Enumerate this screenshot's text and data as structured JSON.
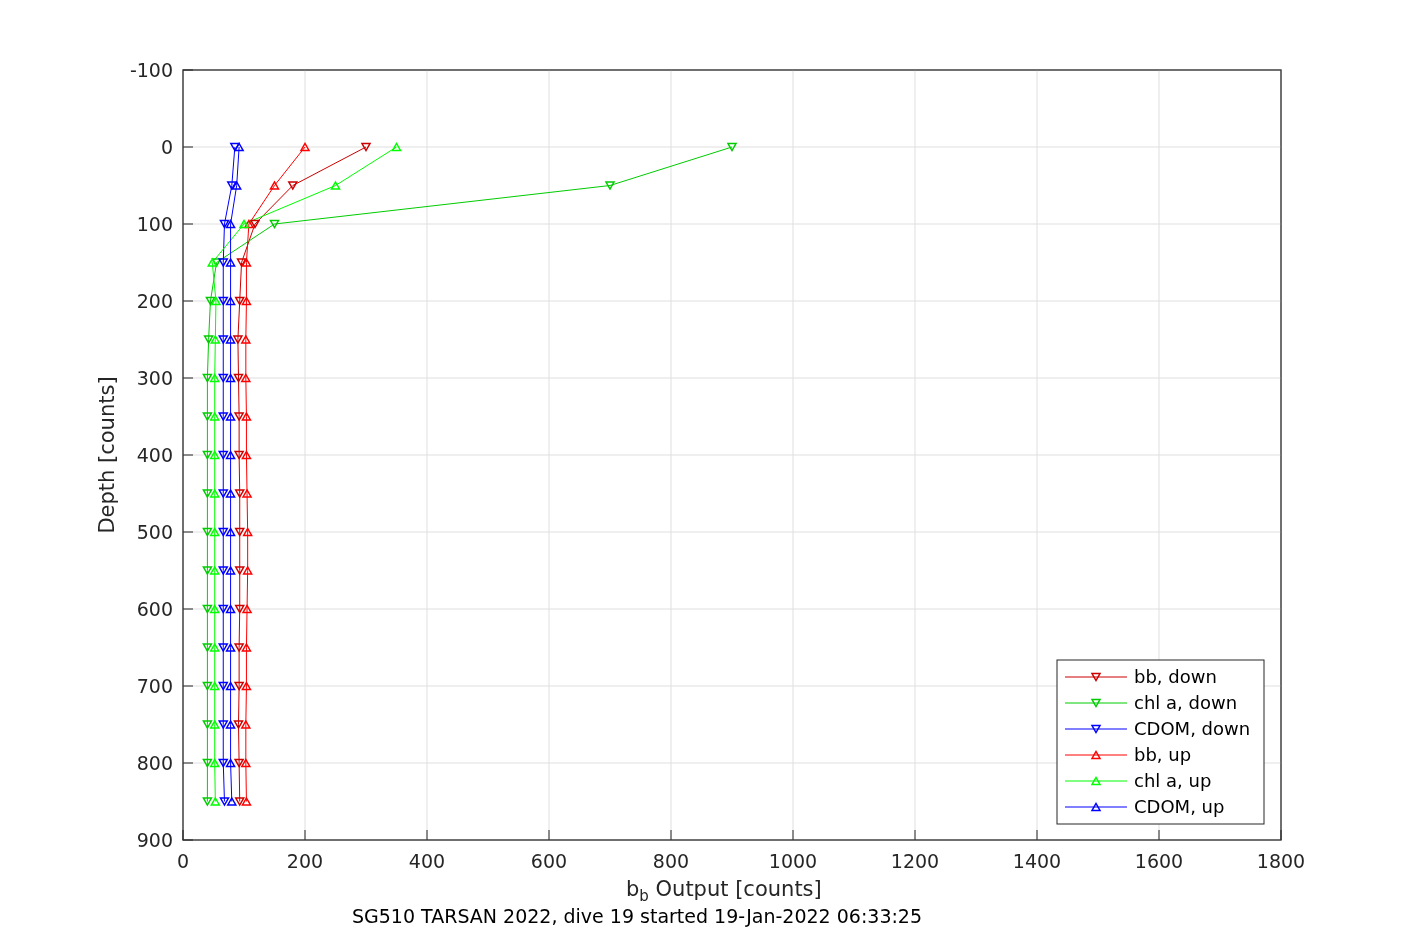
{
  "figure": {
    "chart_data": {
      "type": "line",
      "title": "SG510 TARSAN 2022, dive 19 started 19-Jan-2022 06:33:25",
      "xlabel": "b$_{b}$ Output [counts]",
      "ylabel": "Depth [counts]",
      "orientation": "horizontal",
      "grid": true,
      "legend": "lower right",
      "x": [
        0,
        50,
        100,
        150,
        200,
        250,
        300,
        350,
        400,
        450,
        500,
        550,
        600,
        650,
        700,
        750,
        800,
        850
      ],
      "series": [
        {
          "name": "bb, down",
          "color": "#cc0000",
          "marker": "triangle-down",
          "values": [
            300,
            180,
            118,
            96,
            93,
            90,
            91,
            92,
            92,
            93,
            93,
            93,
            93,
            92,
            92,
            91,
            92,
            93
          ]
        },
        {
          "name": "chl a, down",
          "color": "#00cc00",
          "marker": "triangle-down",
          "values": [
            900,
            700,
            150,
            55,
            45,
            42,
            40,
            40,
            40,
            40,
            40,
            40,
            40,
            40,
            40,
            40,
            40,
            40
          ]
        },
        {
          "name": "CDOM, down",
          "color": "#0000ff",
          "marker": "triangle-down",
          "values": [
            85,
            80,
            68,
            66,
            66,
            66,
            66,
            66,
            66,
            66,
            66,
            66,
            66,
            66,
            66,
            66,
            66,
            68
          ]
        },
        {
          "name": "bb, up",
          "color": "#ff0000",
          "marker": "triangle-up",
          "values": [
            200,
            150,
            108,
            104,
            104,
            103,
            103,
            104,
            104,
            105,
            106,
            106,
            105,
            104,
            104,
            103,
            103,
            104
          ]
        },
        {
          "name": "chl a, up",
          "color": "#00ff00",
          "marker": "triangle-up",
          "values": [
            350,
            250,
            100,
            48,
            54,
            53,
            52,
            52,
            52,
            52,
            52,
            52,
            52,
            52,
            52,
            52,
            52,
            53
          ]
        },
        {
          "name": "CDOM, up",
          "color": "#0000ff",
          "marker": "triangle-up",
          "values": [
            92,
            88,
            78,
            78,
            78,
            78,
            78,
            78,
            78,
            78,
            78,
            78,
            78,
            78,
            78,
            78,
            78,
            80
          ]
        }
      ],
      "xlim": [
        0,
        1800
      ],
      "ylim": [
        900,
        -100
      ],
      "xticks": [
        0,
        200,
        400,
        600,
        800,
        1000,
        1200,
        1400,
        1600,
        1800
      ],
      "yticks": [
        -100,
        0,
        100,
        200,
        300,
        400,
        500,
        600,
        700,
        800,
        900
      ]
    }
  }
}
